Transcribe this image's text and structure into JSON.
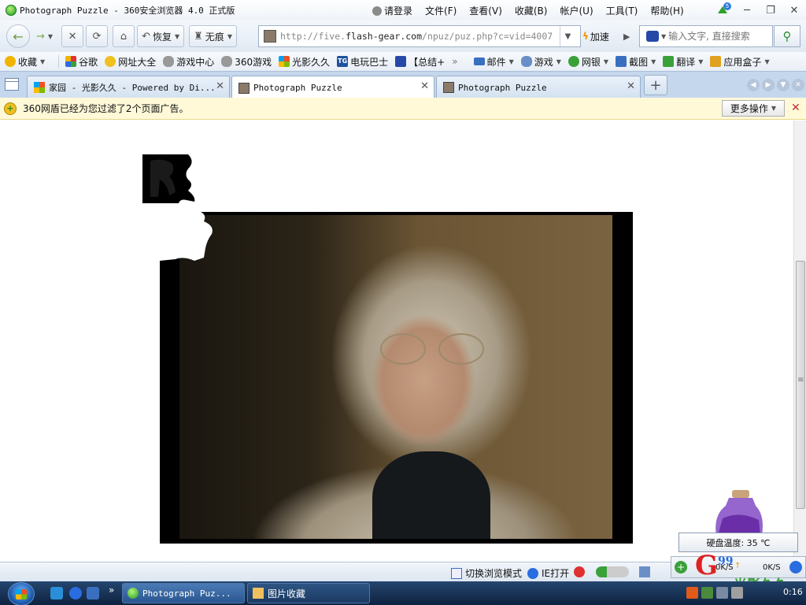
{
  "window": {
    "title": "Photograph Puzzle - 360安全浏览器 4.0 正式版",
    "menu": [
      "请登录",
      "文件(F)",
      "查看(V)",
      "收藏(B)",
      "帐户(U)",
      "工具(T)",
      "帮助(H)"
    ],
    "update_badge": "5"
  },
  "nav": {
    "restore_label": "恢复",
    "incognito_label": "无痕",
    "url_prefix": "http://five.",
    "url_domain": "flash-gear.com",
    "url_path": "/npuz/puz.php?c=vid=4007",
    "speed_label": "加速",
    "search_placeholder": "输入文字, 直接搜索"
  },
  "favorites": [
    {
      "label": "收藏",
      "icon": "star-icon",
      "color": "#f0b400"
    },
    {
      "label": "谷歌",
      "icon": "google-icon",
      "color": "#d93a2a"
    },
    {
      "label": "网址大全",
      "icon": "site-nav-icon",
      "color": "#3aa13a"
    },
    {
      "label": "游戏中心",
      "icon": "gamepad-icon",
      "color": "#888888"
    },
    {
      "label": "360游戏",
      "icon": "gamepad-icon",
      "color": "#888888"
    },
    {
      "label": "光影久久",
      "icon": "windows-flag-icon",
      "color": "#e03030"
    },
    {
      "label": "电玩巴士",
      "icon": "tg-icon",
      "color": "#2050a0"
    },
    {
      "label": "【总结+",
      "icon": "paw-icon",
      "color": "#2649a8"
    }
  ],
  "favorites_right": [
    {
      "label": "邮件",
      "icon": "mail-icon",
      "color": "#3a6fc0"
    },
    {
      "label": "游戏",
      "icon": "gamepad-icon",
      "color": "#3a6fc0"
    },
    {
      "label": "网银",
      "icon": "bank-icon",
      "color": "#3aa13a"
    },
    {
      "label": "截图",
      "icon": "screenshot-icon",
      "color": "#3a6fc0"
    },
    {
      "label": "翻译",
      "icon": "translate-icon",
      "color": "#3aa13a"
    },
    {
      "label": "应用盒子",
      "icon": "app-box-icon",
      "color": "#e0a020"
    }
  ],
  "favorites_overflow": "»",
  "tabs": [
    {
      "label": "家园 - 光影久久 - Powered by Di...",
      "active": false
    },
    {
      "label": "Photograph Puzzle",
      "active": true
    },
    {
      "label": "Photograph Puzzle",
      "active": false
    }
  ],
  "notice": {
    "message": "360网盾已经为您过滤了2个页面广告。",
    "more_label": "更多操作"
  },
  "status": {
    "switch_mode": "切换浏览模式",
    "ie_open": "IE打开",
    "hdd_temp": "硬盘温度: 35 ℃",
    "net_down": "0K/S",
    "net_up": "0K/S",
    "g99_logo": "G",
    "g99_sup": "99",
    "g_caption": "光影久久"
  },
  "taskbar": {
    "items": [
      {
        "label": "Photograph Puz...",
        "active": true
      },
      {
        "label": "图片收藏",
        "active": false
      }
    ],
    "clock": "0:16"
  },
  "colors": {
    "accent": "#2a8a2a",
    "notice_bg": "#fff9d8",
    "tab_bar": "#c5d7ec",
    "taskbar": "#0e2241"
  }
}
